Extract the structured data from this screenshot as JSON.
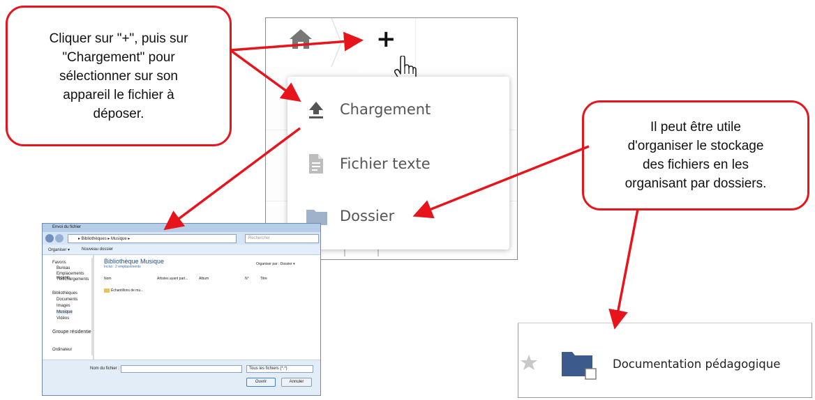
{
  "callouts": {
    "left": "Cliquer sur \"+\", puis sur\n\"Chargement\" pour\nsélectionner sur son\nappareil le fichier à\ndéposer.",
    "right": "Il peut être utile\nd'organiser le stockage\ndes fichiers en les\norganisant par dossiers."
  },
  "menu": {
    "plus_glyph": "+",
    "items": [
      {
        "label": "Chargement",
        "icon": "upload-icon"
      },
      {
        "label": "Fichier texte",
        "icon": "text-file-icon"
      },
      {
        "label": "Dossier",
        "icon": "folder-icon"
      }
    ]
  },
  "dialog": {
    "title": "Envoi du fichier",
    "breadcrumb": "▸ Bibliothèques ▸ Musique ▸",
    "search_placeholder": "Rechercher",
    "toolbar": {
      "organize": "Organiser ▾",
      "new_folder": "Nouveau dossier"
    },
    "sidebar": {
      "favorites_header": "Favoris",
      "favorites": [
        "Bureau",
        "Emplacements récents",
        "Téléchargements"
      ],
      "libraries_header": "Bibliothèques",
      "libraries": [
        "Documents",
        "Images",
        "Musique",
        "Vidéos"
      ],
      "homegroup": "Groupe résidentiel",
      "computer": "Ordinateur"
    },
    "library_title": "Bibliothèque Musique",
    "library_sub": "Inclut : 2 emplacements",
    "arrange_by": "Organiser par : Dossier ▾",
    "columns": [
      "Nom",
      "Artistes ayant part...",
      "Album",
      "N°",
      "Titre"
    ],
    "files": [
      "Échantillons de mu..."
    ],
    "filename_label": "Nom du fichier :",
    "filetype": "Tous les fichiers (*.*)",
    "open_button": "Ouvrir",
    "cancel_button": "Annuler"
  },
  "folder_row": {
    "name": "Documentation pédagogique"
  },
  "colors": {
    "callout_border": "#e8141c",
    "arrow": "#e8141c",
    "folder": "#3d5a8c",
    "menu_icon": "#555555"
  }
}
